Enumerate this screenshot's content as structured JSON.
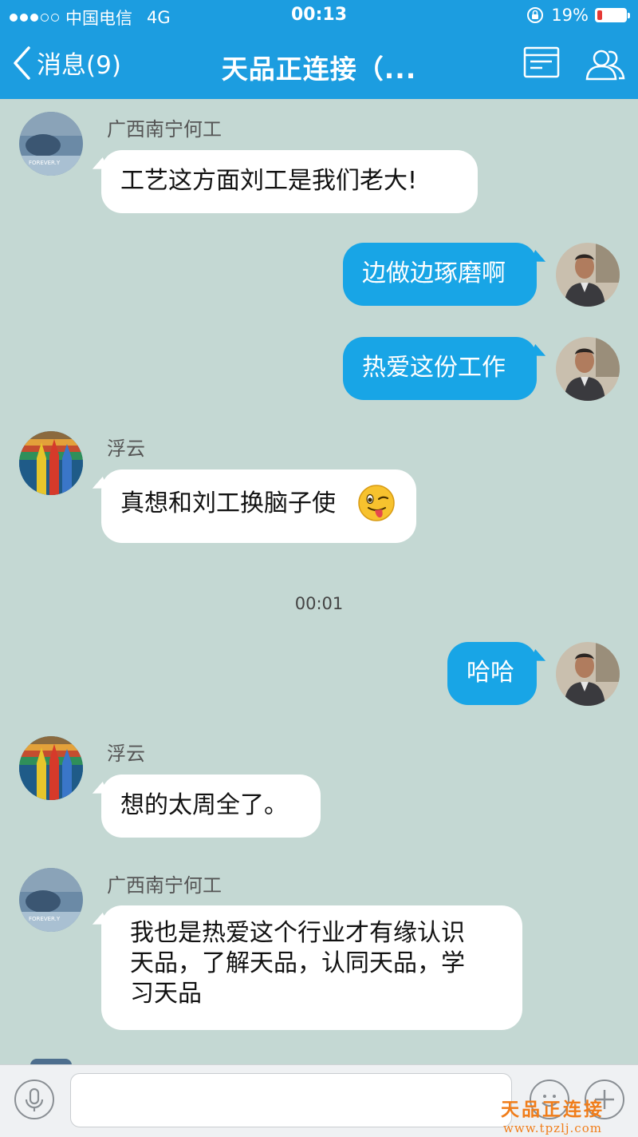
{
  "status_bar": {
    "carrier": "中国电信",
    "network": "4G",
    "time": "00:13",
    "battery": "19%",
    "battery_level": 0.19
  },
  "header": {
    "back_label": "消息(9)",
    "title": "天品正连接（..."
  },
  "messages": [
    {
      "direction": "in",
      "sender": "广西南宁何工",
      "text": "工艺这方面刘工是我们老大!",
      "avatar": "denim-avatar"
    },
    {
      "direction": "out",
      "text": "边做边琢磨啊",
      "avatar": "man-avatar"
    },
    {
      "direction": "out",
      "text": "热爱这份工作",
      "avatar": "man-avatar"
    },
    {
      "direction": "in",
      "sender": "浮云",
      "text": "真想和刘工换脑子使",
      "emoji": "wink-tongue-emoji",
      "avatar": "pencils-avatar"
    },
    {
      "direction": "out",
      "text": "哈哈",
      "avatar": "man-avatar"
    },
    {
      "direction": "in",
      "sender": "浮云",
      "text": "想的太周全了。",
      "avatar": "pencils-avatar"
    },
    {
      "direction": "in",
      "sender": "广西南宁何工",
      "lines": [
        "我也是热爱这个行业才有缘认识",
        "天品，了解天品，认同天品，学",
        "习天品"
      ],
      "avatar": "denim-avatar"
    }
  ],
  "timestamp": "00:01",
  "input": {
    "placeholder": ""
  },
  "watermark": {
    "title": "天品正连接",
    "url": "www.tpzlj.com"
  },
  "colors": {
    "header": "#1c9de0",
    "chat_bg": "#c4d8d3",
    "outgoing_bubble": "#18a5e6",
    "incoming_bubble": "#ffffff",
    "watermark": "#f07d1a"
  }
}
